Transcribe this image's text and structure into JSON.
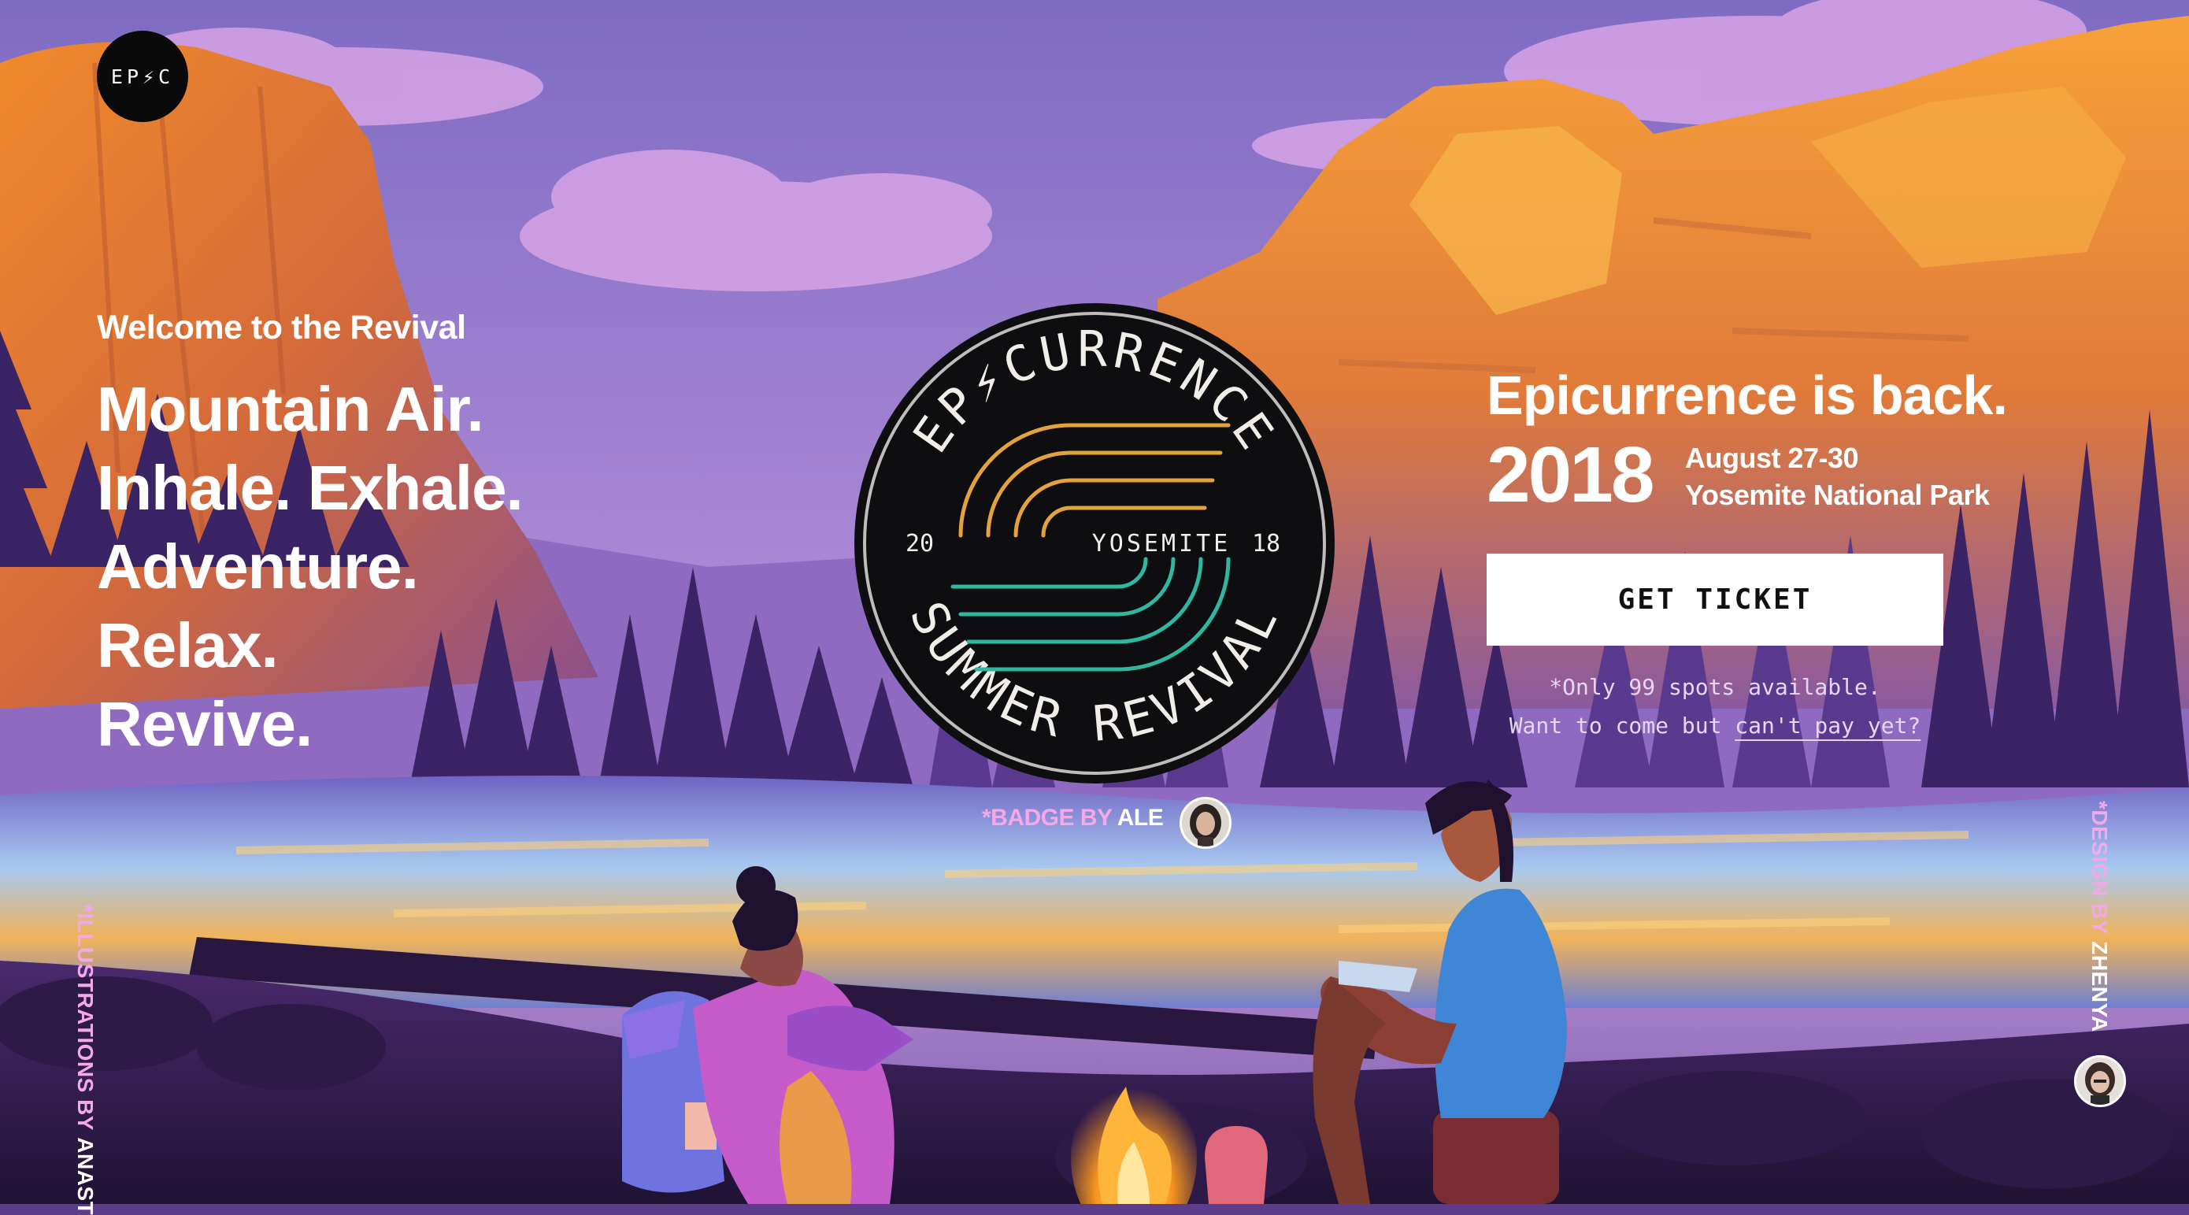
{
  "brand": {
    "logo_text": "EP⚡C"
  },
  "hero": {
    "welcome": "Welcome to the Revival",
    "headlines": [
      "Mountain Air.",
      "Inhale. Exhale.",
      "Adventure.",
      "Relax.",
      "Revive."
    ]
  },
  "badge": {
    "top_arc": "EP⚡CURRENCE",
    "bottom_arc": "SUMMER REVIVAL",
    "left_year": "20",
    "right_year": "18",
    "location": "YOSEMITE",
    "credit_prefix": "*BADGE BY",
    "credit_name": "ALE"
  },
  "event": {
    "tagline": "Epicurrence is back.",
    "year": "2018",
    "dates": "August 27-30",
    "venue": "Yosemite National Park",
    "ticket_label": "GET TICKET",
    "spots_note": "*Only 99 spots available.",
    "cant_pay_prefix": "Want to come but",
    "cant_pay_link": "can't pay yet?"
  },
  "credits": {
    "illustrations_prefix": "*ILLUSTRATIONS BY",
    "illustrations_name": "ANAST",
    "design_prefix": "*DESIGN BY",
    "design_name": "ZHENYA"
  },
  "colors": {
    "sky": "#8b74c6",
    "cliff_orange": "#ea8a2e",
    "lake": "#9cc3e6",
    "accent_pink": "#f4a8e8",
    "badge_gold": "#e3a33a",
    "badge_teal": "#2fb7a0"
  }
}
